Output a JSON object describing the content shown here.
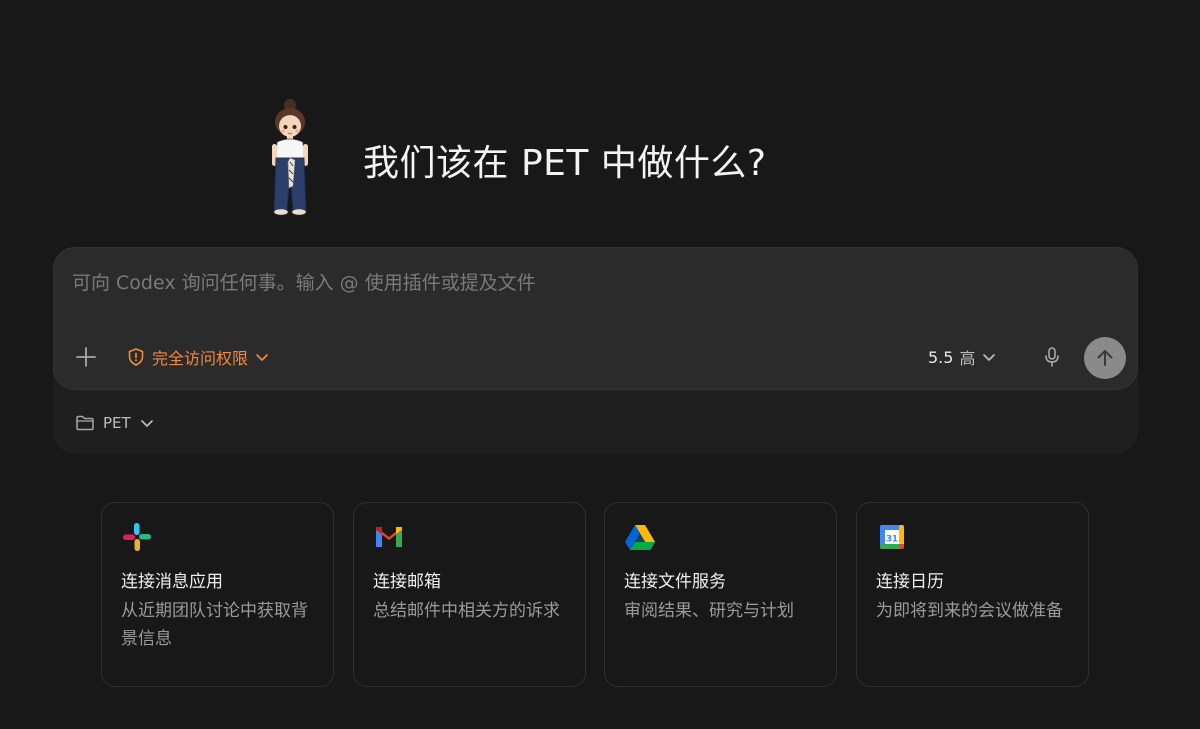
{
  "hero": {
    "title": "我们该在 PET 中做什么?"
  },
  "composer": {
    "placeholder": "可向 Codex 询问任何事。输入 @ 使用插件或提及文件",
    "access_label": "完全访问权限",
    "model_version": "5.5",
    "model_effort": "高",
    "project_label": "PET"
  },
  "cards": [
    {
      "icon": "slack-icon",
      "title": "连接消息应用",
      "desc": "从近期团队讨论中获取背景信息"
    },
    {
      "icon": "gmail-icon",
      "title": "连接邮箱",
      "desc": "总结邮件中相关方的诉求"
    },
    {
      "icon": "google-drive-icon",
      "title": "连接文件服务",
      "desc": "审阅结果、研究与计划"
    },
    {
      "icon": "google-calendar-icon",
      "title": "连接日历",
      "desc": "为即将到来的会议做准备",
      "calendar_day": "31"
    }
  ],
  "colors": {
    "background": "#181818",
    "composer": "#2b2b2b",
    "accent_access": "#f08a3c",
    "send_button": "#8a8a8a"
  }
}
